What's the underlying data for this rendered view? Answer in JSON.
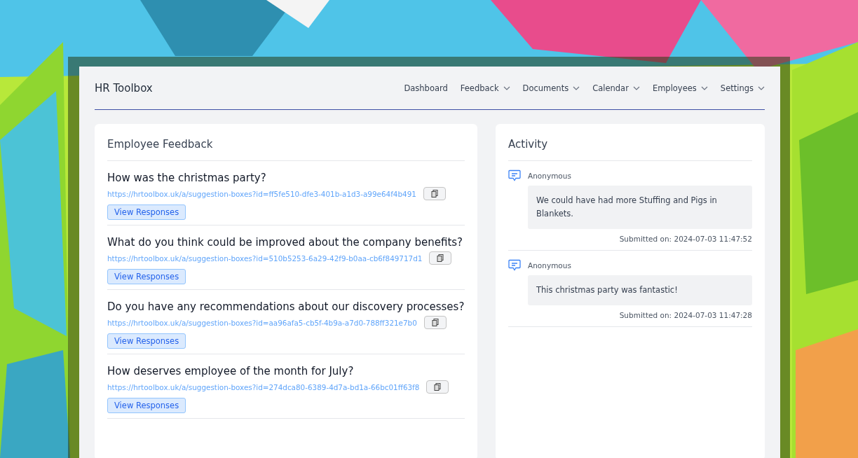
{
  "app": {
    "title": "HR Toolbox"
  },
  "nav": [
    {
      "label": "Dashboard",
      "has_menu": false
    },
    {
      "label": "Feedback",
      "has_menu": true
    },
    {
      "label": "Documents",
      "has_menu": true
    },
    {
      "label": "Calendar",
      "has_menu": true
    },
    {
      "label": "Employees",
      "has_menu": true
    },
    {
      "label": "Settings",
      "has_menu": true
    }
  ],
  "feedback": {
    "title": "Employee Feedback",
    "boxes": [
      {
        "question": "How was the christmas party?",
        "url": "https://hrtoolbox.uk/a/suggestion-boxes?id=ff5fe510-dfe3-401b-a1d3-a99e64f4b491",
        "button_label": "View Responses"
      },
      {
        "question": "What do you think could be improved about the company benefits?",
        "url": "https://hrtoolbox.uk/a/suggestion-boxes?id=510b5253-6a29-42f9-b0aa-cb6f849717d1",
        "button_label": "View Responses"
      },
      {
        "question": "Do you have any recommendations about our discovery processes?",
        "url": "https://hrtoolbox.uk/a/suggestion-boxes?id=aa96afa5-cb5f-4b9a-a7d0-788ff321e7b0",
        "button_label": "View Responses"
      },
      {
        "question": "How deserves employee of the month for July?",
        "url": "https://hrtoolbox.uk/a/suggestion-boxes?id=274dca80-6389-4d7a-bd1a-66bc01ff63f8",
        "button_label": "View Responses"
      }
    ]
  },
  "activity": {
    "title": "Activity",
    "items": [
      {
        "author": "Anonymous",
        "message": "We could have had more Stuffing and Pigs in Blankets.",
        "submitted": "Submitted on: 2024-07-03 11:47:52"
      },
      {
        "author": "Anonymous",
        "message": "This christmas party was fantastic!",
        "submitted": "Submitted on: 2024-07-03 11:47:28"
      }
    ]
  }
}
